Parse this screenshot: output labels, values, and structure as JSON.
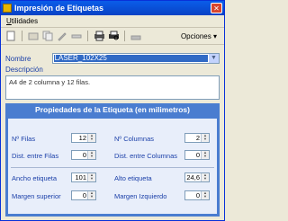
{
  "window": {
    "title": "Impresión de Etiquetas",
    "close_glyph": "✕"
  },
  "menu": {
    "utilidades_first": "U",
    "utilidades_rest": "tilidades"
  },
  "toolbar": {
    "opciones_label": "Opciones",
    "opciones_arrow": "▾"
  },
  "form": {
    "nombre_label": "Nombre",
    "nombre_value": "LASER_102X25",
    "descripcion_label": "Descripción",
    "descripcion_value": "A4 de 2 columna y 12 filas."
  },
  "props": {
    "title": "Propiedades de la Etiqueta (en milimetros)",
    "filas_label": "Nº Filas",
    "filas_value": "12",
    "columnas_label": "Nº Columnas",
    "columnas_value": "2",
    "dist_filas_label": "Dist. entre Filas",
    "dist_filas_value": "0",
    "dist_columnas_label": "Dist. entre Columnas",
    "dist_columnas_value": "0",
    "ancho_label": "Ancho etiqueta",
    "ancho_value": "101",
    "alto_label": "Alto etiqueta",
    "alto_value": "24,6",
    "margen_sup_label": "Margen superior",
    "margen_sup_value": "0",
    "margen_izq_label": "Margen Izquierdo",
    "margen_izq_value": "0"
  },
  "colors": {
    "title_bar": "#0A5DE9",
    "props_header": "#4A7DD0",
    "label_blue": "#1A3FA8",
    "selection": "#316AC5"
  }
}
